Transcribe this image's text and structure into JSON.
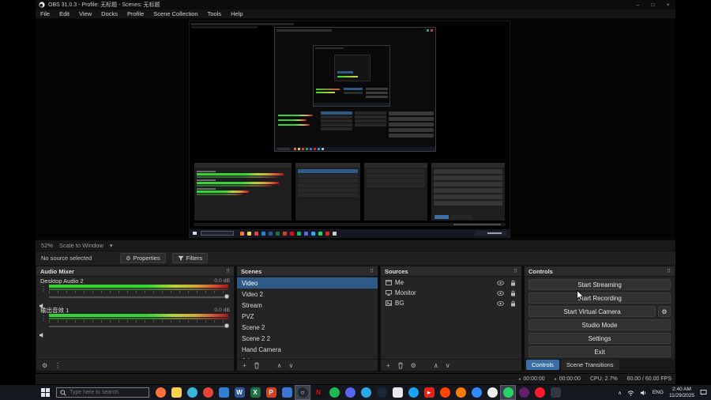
{
  "colors": {
    "accent": "#2e5a87",
    "tab_active": "#3a6ea5",
    "taskbar_active": "#3d424e"
  },
  "icons": {
    "dock": "⠿",
    "kebab": "⋮",
    "gear": "⚙",
    "caret": "▾",
    "plus": "+",
    "up": "∧",
    "down": "∨",
    "dot": "●",
    "tray_chevron": "∧"
  },
  "window": {
    "title": "OBS 31.0.3 - Profile: 无标题 - Scenes: 无标题",
    "minimize": "–",
    "maximize": "□",
    "close": "×",
    "menus": [
      "File",
      "Edit",
      "View",
      "Docks",
      "Profile",
      "Scene Collection",
      "Tools",
      "Help"
    ]
  },
  "preview_toolbar": {
    "zoom": "52%",
    "scale_mode": "Scale to Window"
  },
  "source_toolbar": {
    "status": "No source selected",
    "properties": "Properties",
    "filters": "Filters"
  },
  "audio_mixer": {
    "title": "Audio Mixer",
    "channels": [
      {
        "name": "Desktop Audio 2",
        "level": "0.0 dB"
      },
      {
        "name": "输出音效 1",
        "level": "0.0 dB"
      }
    ]
  },
  "scenes": {
    "title": "Scenes",
    "selected": "Video",
    "items": [
      "Video",
      "Video 2",
      "Stream",
      "PVZ",
      "Scene 2",
      "Scene 2 2",
      "Hand Camera",
      "Ad"
    ]
  },
  "sources": {
    "title": "Sources",
    "items": [
      {
        "label": "Me"
      },
      {
        "label": "Monitor"
      },
      {
        "label": "BG"
      }
    ]
  },
  "controls": {
    "title": "Controls",
    "start_streaming": "Start Streaming",
    "start_recording": "Start Recording",
    "start_virtual_camera": "Start Virtual Camera",
    "studio_mode": "Studio Mode",
    "settings": "Settings",
    "exit": "Exit"
  },
  "dock_tabs": {
    "controls": "Controls",
    "scene_transitions": "Scene Transitions"
  },
  "status_bar": {
    "stream_time": "00:00:00",
    "rec_time": "00:00:00",
    "cpu": "CPU: 2.7%",
    "fps": "60.00 / 60.00 FPS"
  },
  "taskbar": {
    "search_placeholder": "Type here to search",
    "language": "ENG",
    "time": "2:40 AM",
    "date": "11/29/2025",
    "apps": [
      {
        "name": "firefox",
        "bg": "#ff7139",
        "round": true
      },
      {
        "name": "file-explorer",
        "bg": "#ffd04a"
      },
      {
        "name": "edge",
        "bg": "#35b8d9",
        "round": true
      },
      {
        "name": "chrome",
        "bg": "#e84335",
        "round": true
      },
      {
        "name": "vscode",
        "bg": "#2f7fd4"
      },
      {
        "name": "word",
        "bg": "#2b579a",
        "glyph": "W"
      },
      {
        "name": "excel",
        "bg": "#1e7145",
        "glyph": "X"
      },
      {
        "name": "powerpoint",
        "bg": "#d04423",
        "glyph": "P"
      },
      {
        "name": "photos",
        "bg": "#3a76d2"
      },
      {
        "name": "obs",
        "bg": "#23272e",
        "glyph": "○",
        "fg": "#ffffff",
        "round": true,
        "active": true
      },
      {
        "name": "netflix",
        "bg": "#141414",
        "glyph": "N",
        "fg": "#e50914"
      },
      {
        "name": "spotify",
        "bg": "#1db954",
        "round": true
      },
      {
        "name": "discord",
        "bg": "#5865f2",
        "round": true
      },
      {
        "name": "telegram",
        "bg": "#29a9eb",
        "round": true
      },
      {
        "name": "steam",
        "bg": "#1b2838",
        "round": true
      },
      {
        "name": "notepad",
        "bg": "#e9e9e9",
        "fg": "#333333"
      },
      {
        "name": "twitter",
        "bg": "#1da1f2",
        "round": true
      },
      {
        "name": "youtube",
        "bg": "#e62117",
        "glyph": "▸"
      },
      {
        "name": "reddit",
        "bg": "#ff4500",
        "round": true
      },
      {
        "name": "vlc",
        "bg": "#ff7b00",
        "round": true
      },
      {
        "name": "zoom",
        "bg": "#2d8cff",
        "round": true
      },
      {
        "name": "github",
        "bg": "#f0f0f0",
        "round": true
      },
      {
        "name": "whatsapp",
        "bg": "#25d366",
        "round": true,
        "active": true
      },
      {
        "name": "slack",
        "bg": "#611f69",
        "round": true
      },
      {
        "name": "opera",
        "bg": "#ff1b2d",
        "round": true
      },
      {
        "name": "epic",
        "bg": "#333640"
      }
    ]
  },
  "preview_decor": {
    "l1_meter_widths": [
      110,
      104,
      66
    ],
    "l2_meter_widths": [
      44,
      36,
      40
    ],
    "l1_scene_rows": 6,
    "l1_source_rows": 4,
    "l1_control_buttons": 6,
    "l2_scene_rows": 5,
    "l2_source_rows": 4,
    "l2_control_buttons": 5,
    "l1_taskbar_dots": [
      "#ff7139",
      "#ffd04a",
      "#e84335",
      "#2f7fd4",
      "#2b579a",
      "#1e7145",
      "#d04423",
      "#e50914",
      "#1db954",
      "#5865f2",
      "#29a9eb",
      "#25d366",
      "#e62117",
      "#cccccc"
    ],
    "l2_taskbar_dots": [
      "#ff7139",
      "#ffd04a",
      "#e84335",
      "#1db954",
      "#5865f2",
      "#e62117",
      "#29a9eb",
      "#cccccc"
    ]
  }
}
